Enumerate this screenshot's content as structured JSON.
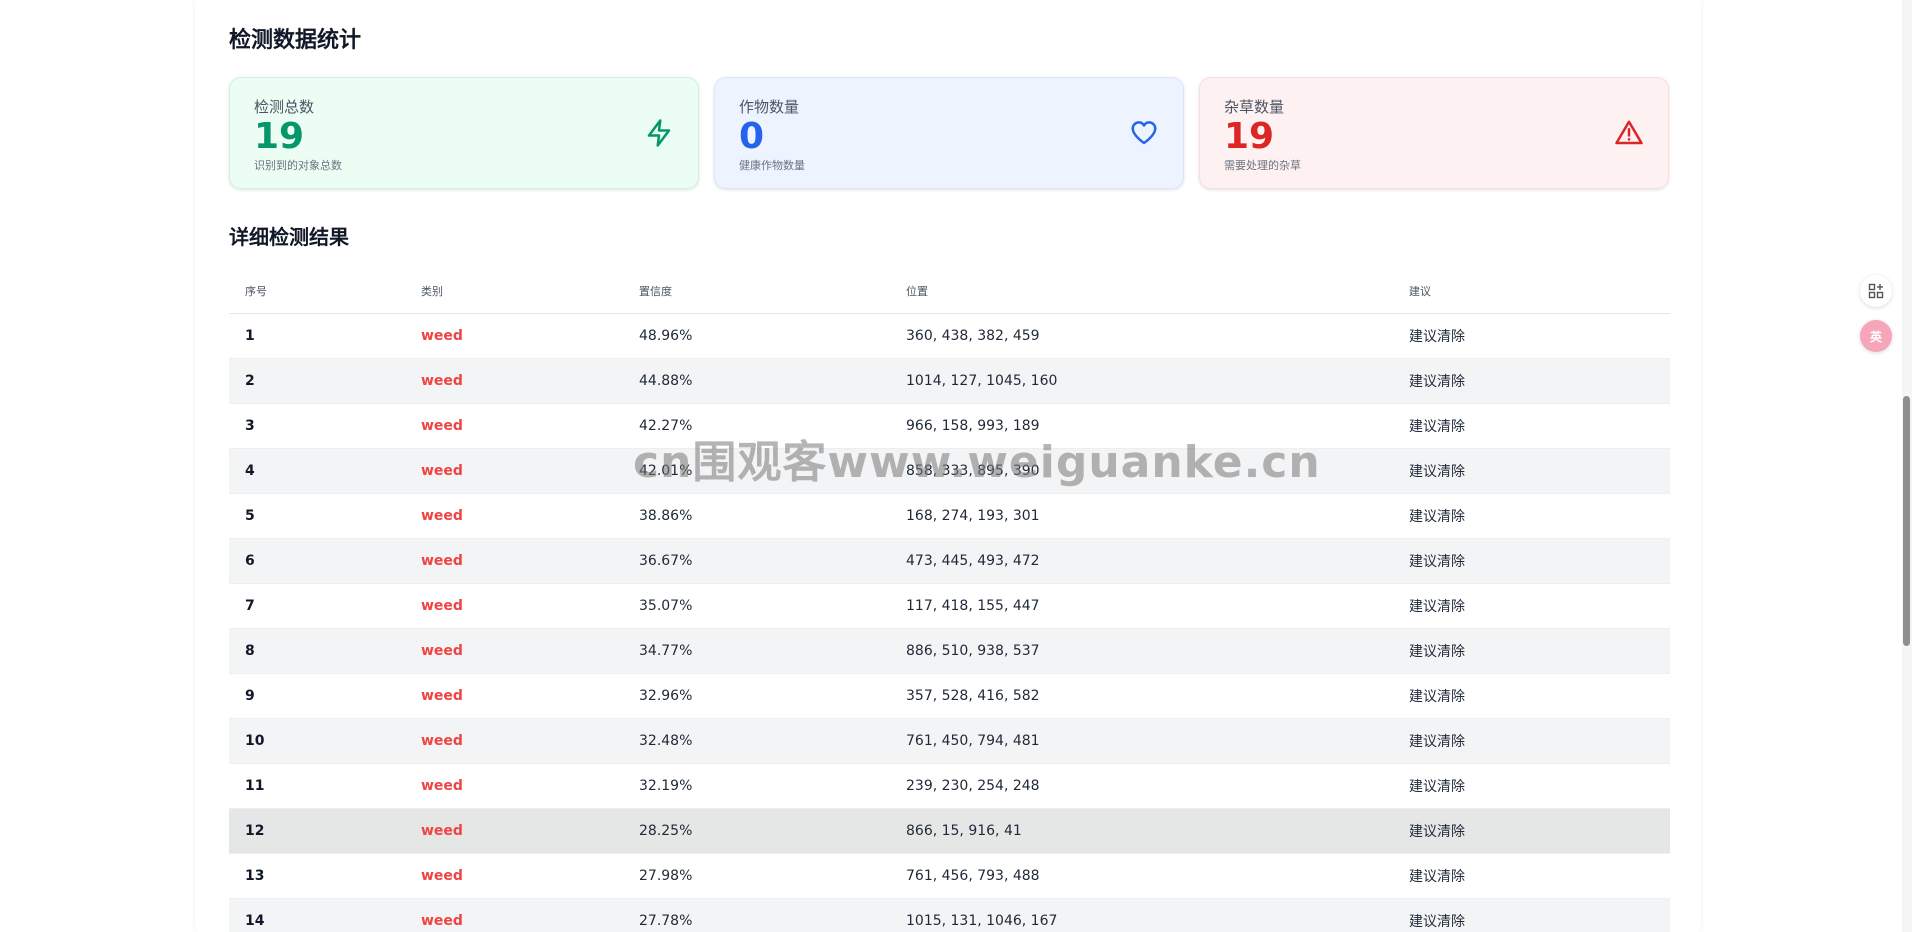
{
  "stats": {
    "title": "检测数据统计",
    "cards": [
      {
        "label": "检测总数",
        "value": "19",
        "sub": "识别到的对象总数",
        "icon": "lightning-icon",
        "color": "#059669"
      },
      {
        "label": "作物数量",
        "value": "0",
        "sub": "健康作物数量",
        "icon": "heart-icon",
        "color": "#2563eb"
      },
      {
        "label": "杂草数量",
        "value": "19",
        "sub": "需要处理的杂草",
        "icon": "warning-icon",
        "color": "#dc2626"
      }
    ]
  },
  "detail": {
    "title": "详细检测结果",
    "columns": [
      "序号",
      "类别",
      "置信度",
      "位置",
      "建议"
    ],
    "rows": [
      {
        "idx": "1",
        "cls": "weed",
        "conf": "48.96%",
        "pos": "360, 438, 382, 459",
        "advice": "建议清除"
      },
      {
        "idx": "2",
        "cls": "weed",
        "conf": "44.88%",
        "pos": "1014, 127, 1045, 160",
        "advice": "建议清除"
      },
      {
        "idx": "3",
        "cls": "weed",
        "conf": "42.27%",
        "pos": "966, 158, 993, 189",
        "advice": "建议清除"
      },
      {
        "idx": "4",
        "cls": "weed",
        "conf": "42.01%",
        "pos": "858, 333, 895, 390",
        "advice": "建议清除"
      },
      {
        "idx": "5",
        "cls": "weed",
        "conf": "38.86%",
        "pos": "168, 274, 193, 301",
        "advice": "建议清除"
      },
      {
        "idx": "6",
        "cls": "weed",
        "conf": "36.67%",
        "pos": "473, 445, 493, 472",
        "advice": "建议清除"
      },
      {
        "idx": "7",
        "cls": "weed",
        "conf": "35.07%",
        "pos": "117, 418, 155, 447",
        "advice": "建议清除"
      },
      {
        "idx": "8",
        "cls": "weed",
        "conf": "34.77%",
        "pos": "886, 510, 938, 537",
        "advice": "建议清除"
      },
      {
        "idx": "9",
        "cls": "weed",
        "conf": "32.96%",
        "pos": "357, 528, 416, 582",
        "advice": "建议清除"
      },
      {
        "idx": "10",
        "cls": "weed",
        "conf": "32.48%",
        "pos": "761, 450, 794, 481",
        "advice": "建议清除"
      },
      {
        "idx": "11",
        "cls": "weed",
        "conf": "32.19%",
        "pos": "239, 230, 254, 248",
        "advice": "建议清除"
      },
      {
        "idx": "12",
        "cls": "weed",
        "conf": "28.25%",
        "pos": "866, 15, 916, 41",
        "advice": "建议清除"
      },
      {
        "idx": "13",
        "cls": "weed",
        "conf": "27.98%",
        "pos": "761, 456, 793, 488",
        "advice": "建议清除"
      },
      {
        "idx": "14",
        "cls": "weed",
        "conf": "27.78%",
        "pos": "1015, 131, 1046, 167",
        "advice": "建议清除"
      }
    ]
  },
  "watermark": "cn围观客www.weiguanke.cn",
  "floating": [
    {
      "icon": "apps-add-icon"
    },
    {
      "icon": "translate-icon",
      "label": "英"
    }
  ]
}
